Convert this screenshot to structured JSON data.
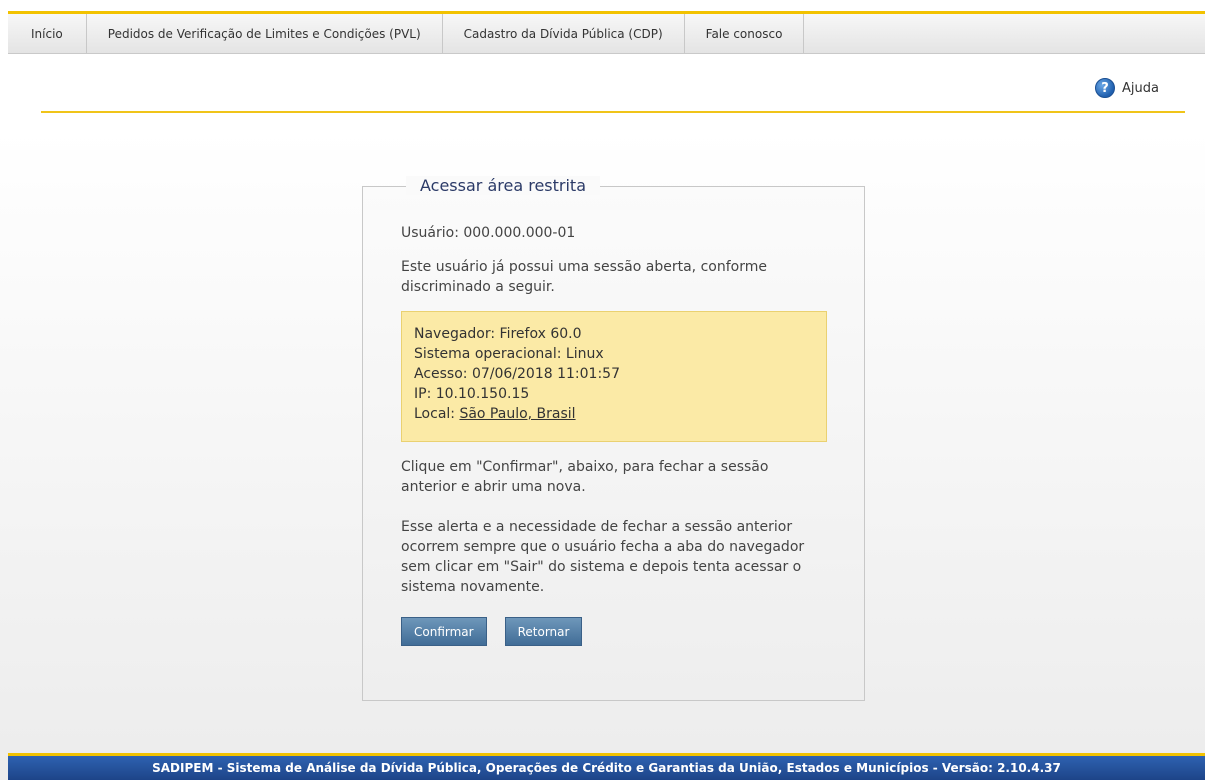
{
  "nav": {
    "items": [
      {
        "label": "Início"
      },
      {
        "label": "Pedidos de Verificação de Limites e Condições (PVL)"
      },
      {
        "label": "Cadastro da Dívida Pública (CDP)"
      },
      {
        "label": "Fale conosco"
      }
    ]
  },
  "help": {
    "icon": "help-question-icon",
    "label": "Ajuda"
  },
  "panel": {
    "title": "Acessar área restrita",
    "user_text": "Usuário: 000.000.000-01",
    "intro_text": "Este usuário já possui uma sessão aberta, conforme discriminado a seguir.",
    "session": {
      "browser": "Navegador: Firefox 60.0",
      "os": "Sistema operacional: Linux",
      "access": "Acesso: 07/06/2018 11:01:57",
      "ip": "IP: 10.10.150.15",
      "location_prefix": "Local: ",
      "location_link": "São Paulo, Brasil"
    },
    "confirm_text": "Clique em \"Confirmar\", abaixo, para fechar a sessão anterior e abrir uma nova.",
    "alert_text": "Esse alerta e a necessidade de fechar a sessão anterior ocorrem sempre que o usuário fecha a aba do navegador sem clicar em \"Sair\" do sistema e depois tenta acessar o sistema novamente.",
    "buttons": {
      "confirm": "Confirmar",
      "back": "Retornar"
    }
  },
  "footer": {
    "text": "SADIPEM - Sistema de Análise da Dívida Pública, Operações de Crédito e Garantias da União, Estados e Municípios - Versão: 2.10.4.37"
  },
  "colors": {
    "accent_yellow": "#f2c200",
    "button_blue": "#416d97",
    "footer_blue": "#1d4488",
    "info_box": "#fbeaa6",
    "title_navy": "#2b3a67"
  }
}
